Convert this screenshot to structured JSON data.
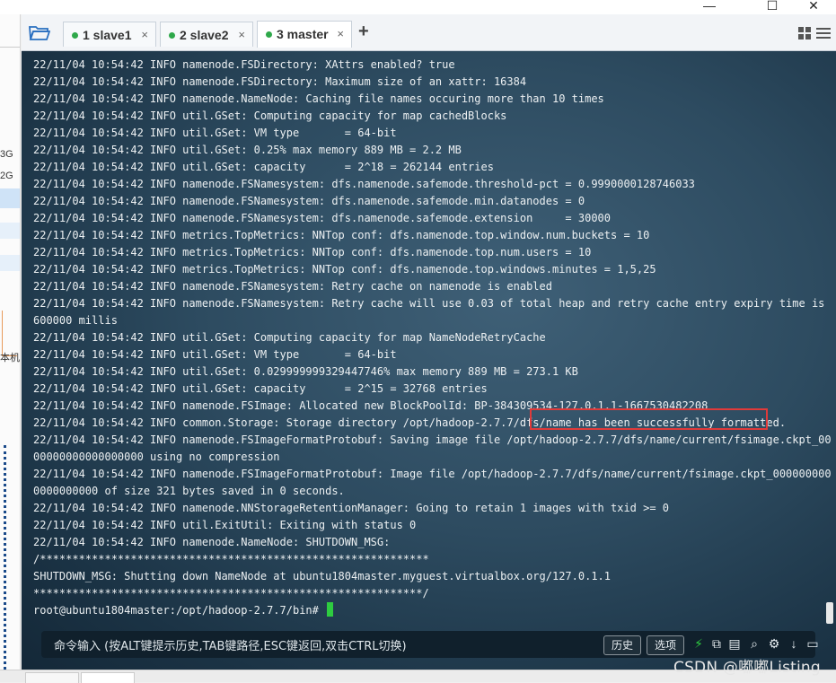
{
  "window": {
    "minimize_glyph": "—",
    "maximize_glyph": "☐",
    "close_glyph": "✕"
  },
  "tabs": [
    {
      "label": "1 slave1",
      "close": "×",
      "active": false
    },
    {
      "label": "2 slave2",
      "close": "×",
      "active": false
    },
    {
      "label": "3 master",
      "close": "×",
      "active": true
    }
  ],
  "new_tab_glyph": "+",
  "left_fragments": [
    "3G",
    "2G",
    "本机"
  ],
  "terminal": {
    "lines": [
      "22/11/04 10:54:42 INFO namenode.FSDirectory: XAttrs enabled? true",
      "22/11/04 10:54:42 INFO namenode.FSDirectory: Maximum size of an xattr: 16384",
      "22/11/04 10:54:42 INFO namenode.NameNode: Caching file names occuring more than 10 times",
      "22/11/04 10:54:42 INFO util.GSet: Computing capacity for map cachedBlocks",
      "22/11/04 10:54:42 INFO util.GSet: VM type       = 64-bit",
      "22/11/04 10:54:42 INFO util.GSet: 0.25% max memory 889 MB = 2.2 MB",
      "22/11/04 10:54:42 INFO util.GSet: capacity      = 2^18 = 262144 entries",
      "22/11/04 10:54:42 INFO namenode.FSNamesystem: dfs.namenode.safemode.threshold-pct = 0.9990000128746033",
      "22/11/04 10:54:42 INFO namenode.FSNamesystem: dfs.namenode.safemode.min.datanodes = 0",
      "22/11/04 10:54:42 INFO namenode.FSNamesystem: dfs.namenode.safemode.extension     = 30000",
      "22/11/04 10:54:42 INFO metrics.TopMetrics: NNTop conf: dfs.namenode.top.window.num.buckets = 10",
      "22/11/04 10:54:42 INFO metrics.TopMetrics: NNTop conf: dfs.namenode.top.num.users = 10",
      "22/11/04 10:54:42 INFO metrics.TopMetrics: NNTop conf: dfs.namenode.top.windows.minutes = 1,5,25",
      "22/11/04 10:54:42 INFO namenode.FSNamesystem: Retry cache on namenode is enabled",
      "22/11/04 10:54:42 INFO namenode.FSNamesystem: Retry cache will use 0.03 of total heap and retry cache entry expiry time is",
      "600000 millis",
      "22/11/04 10:54:42 INFO util.GSet: Computing capacity for map NameNodeRetryCache",
      "22/11/04 10:54:42 INFO util.GSet: VM type       = 64-bit",
      "22/11/04 10:54:42 INFO util.GSet: 0.029999999329447746% max memory 889 MB = 273.1 KB",
      "22/11/04 10:54:42 INFO util.GSet: capacity      = 2^15 = 32768 entries",
      "22/11/04 10:54:42 INFO namenode.FSImage: Allocated new BlockPoolId: BP-384309534-127.0.1.1-1667530482208",
      "22/11/04 10:54:42 INFO common.Storage: Storage directory /opt/hadoop-2.7.7/dfs/name has been successfully formatted.",
      "22/11/04 10:54:42 INFO namenode.FSImageFormatProtobuf: Saving image file /opt/hadoop-2.7.7/dfs/name/current/fsimage.ckpt_00",
      "00000000000000000 using no compression",
      "22/11/04 10:54:42 INFO namenode.FSImageFormatProtobuf: Image file /opt/hadoop-2.7.7/dfs/name/current/fsimage.ckpt_000000000",
      "0000000000 of size 321 bytes saved in 0 seconds.",
      "22/11/04 10:54:42 INFO namenode.NNStorageRetentionManager: Going to retain 1 images with txid >= 0",
      "22/11/04 10:54:42 INFO util.ExitUtil: Exiting with status 0",
      "22/11/04 10:54:42 INFO namenode.NameNode: SHUTDOWN_MSG:",
      "/************************************************************",
      "SHUTDOWN_MSG: Shutting down NameNode at ubuntu1804master.myguest.virtualbox.org/127.0.1.1",
      "************************************************************/"
    ],
    "prompt": "root@ubuntu1804master:/opt/hadoop-2.7.7/bin# "
  },
  "cmdbar": {
    "label": "命令输入 (按ALT键提示历史,TAB键路径,ESC键返回,双击CTRL切换)",
    "history_button": "历史",
    "options_button": "选项"
  },
  "watermark": "CSDN @嘟嘟Listing",
  "colors": {
    "highlight_box": "#e03a3a",
    "cursor": "#2ecc40",
    "active_dot": "#2ea84a"
  }
}
